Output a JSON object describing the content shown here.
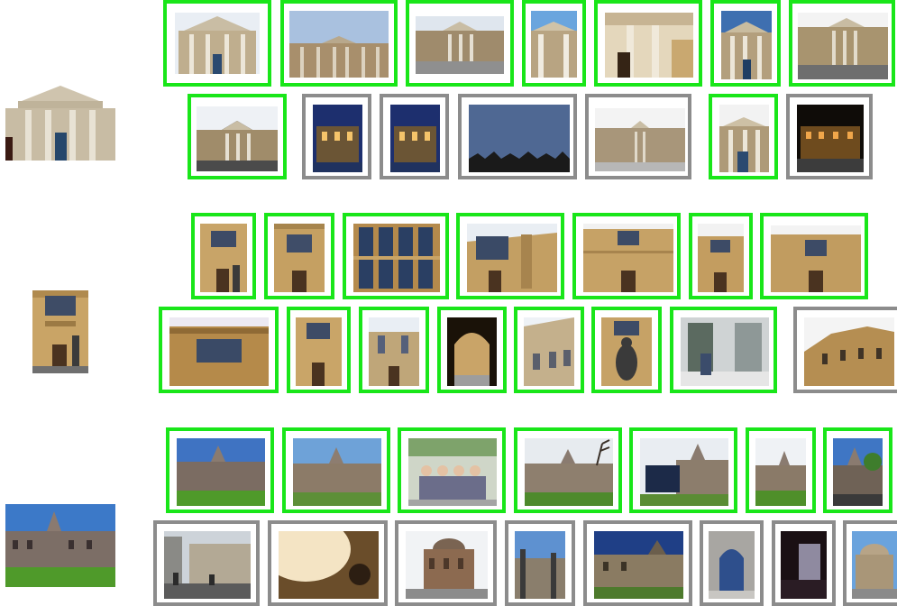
{
  "colors": {
    "match_border": "#19e619",
    "nonmatch_border": "#8c8c8c",
    "background": "#ffffff"
  },
  "groups": [
    {
      "query_scene": "classical-building",
      "rows": [
        [
          "match",
          "match",
          "match",
          "match",
          "match",
          "match",
          "match"
        ],
        [
          "match",
          "nonmatch",
          "nonmatch",
          "nonmatch",
          "nonmatch",
          "match",
          "nonmatch"
        ]
      ]
    },
    {
      "query_scene": "library-facade",
      "rows": [
        [
          "match",
          "match",
          "match",
          "match",
          "match",
          "match",
          "match"
        ],
        [
          "match",
          "match",
          "match",
          "match",
          "match",
          "match",
          "match",
          "nonmatch"
        ]
      ]
    },
    {
      "query_scene": "gothic-museum",
      "rows": [
        [
          "match",
          "match",
          "match",
          "match",
          "match",
          "match",
          "match"
        ],
        [
          "nonmatch",
          "nonmatch",
          "nonmatch",
          "nonmatch",
          "nonmatch",
          "nonmatch",
          "nonmatch",
          "nonmatch"
        ]
      ]
    }
  ]
}
